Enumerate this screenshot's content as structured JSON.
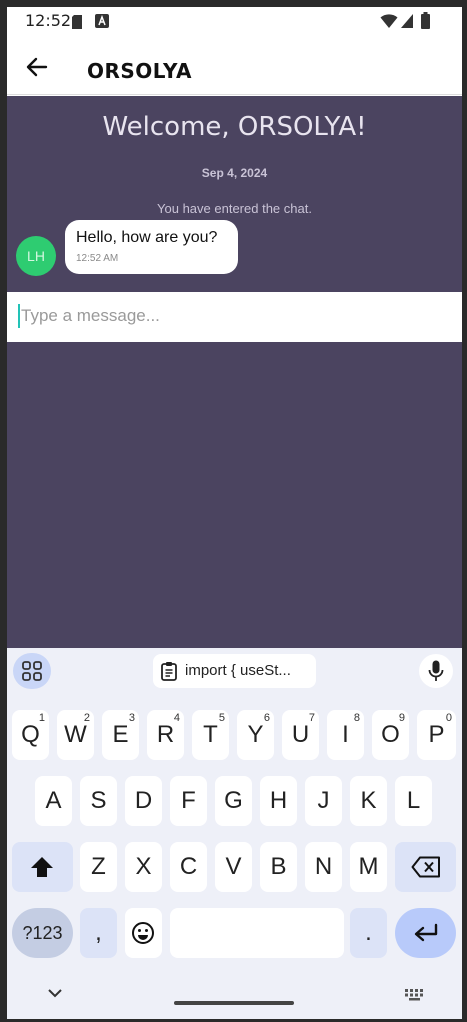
{
  "status_bar": {
    "time": "12:52",
    "icons": [
      "sd-card-icon",
      "text-a-icon",
      "wifi-icon",
      "signal-icon",
      "battery-icon"
    ]
  },
  "app_bar": {
    "title": "ORSOLYA",
    "back_icon": "arrow-left-icon"
  },
  "chat": {
    "welcome": "Welcome, ORSOLYA!",
    "date": "Sep 4, 2024",
    "system_message": "You have entered the chat.",
    "messages": [
      {
        "avatar_initials": "LH",
        "avatar_color": "#2ecc71",
        "text": "Hello, how are you?",
        "time": "12:52 AM"
      }
    ],
    "input": {
      "placeholder": "Type a message...",
      "value": ""
    },
    "background_color": "#4b4460"
  },
  "keyboard": {
    "clipboard_suggestion": "import { useSt...",
    "row1": [
      {
        "label": "Q",
        "hint": "1"
      },
      {
        "label": "W",
        "hint": "2"
      },
      {
        "label": "E",
        "hint": "3"
      },
      {
        "label": "R",
        "hint": "4"
      },
      {
        "label": "T",
        "hint": "5"
      },
      {
        "label": "Y",
        "hint": "6"
      },
      {
        "label": "U",
        "hint": "7"
      },
      {
        "label": "I",
        "hint": "8"
      },
      {
        "label": "O",
        "hint": "9"
      },
      {
        "label": "P",
        "hint": "0"
      }
    ],
    "row2": [
      "A",
      "S",
      "D",
      "F",
      "G",
      "H",
      "J",
      "K",
      "L"
    ],
    "row3": [
      "Z",
      "X",
      "C",
      "V",
      "B",
      "N",
      "M"
    ],
    "symbols_label": "?123",
    "comma_label": ",",
    "period_label": ".",
    "accent_color": "#b8cafa"
  }
}
